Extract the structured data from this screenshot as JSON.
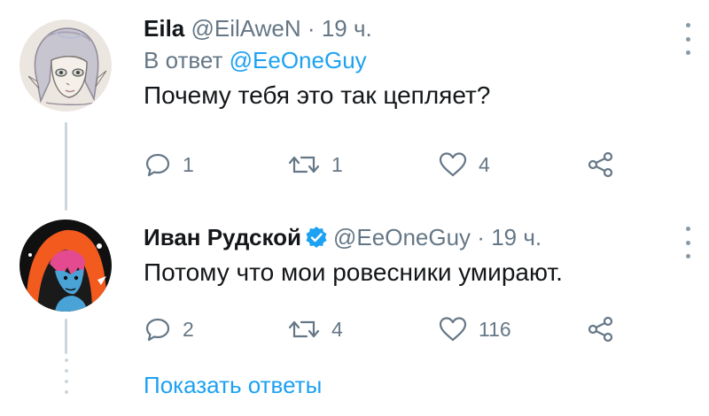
{
  "tweets": [
    {
      "name": "Eila",
      "handle": "@EilAweN",
      "separator": "·",
      "time": "19 ч.",
      "reply_prefix": "В ответ",
      "reply_mention": "@EeOneGuy",
      "text": "Почему тебя это так цепляет?",
      "actions": {
        "reply": "1",
        "retweet": "1",
        "like": "4"
      },
      "avatar_icon": "anime-girl-sketch-avatar"
    },
    {
      "name": "Иван Рудской",
      "handle": "@EeOneGuy",
      "separator": "·",
      "time": "19 ч.",
      "verified": true,
      "text": "Потому что мои ровесники умирают.",
      "actions": {
        "reply": "2",
        "retweet": "4",
        "like": "116"
      },
      "avatar_icon": "orange-hood-character-avatar"
    }
  ],
  "show_replies": "Показать ответы",
  "colors": {
    "link": "#1da1f2",
    "muted": "#657786",
    "text": "#14171a",
    "verified": "#1da1f2",
    "thread_line": "#ccd6dd"
  }
}
